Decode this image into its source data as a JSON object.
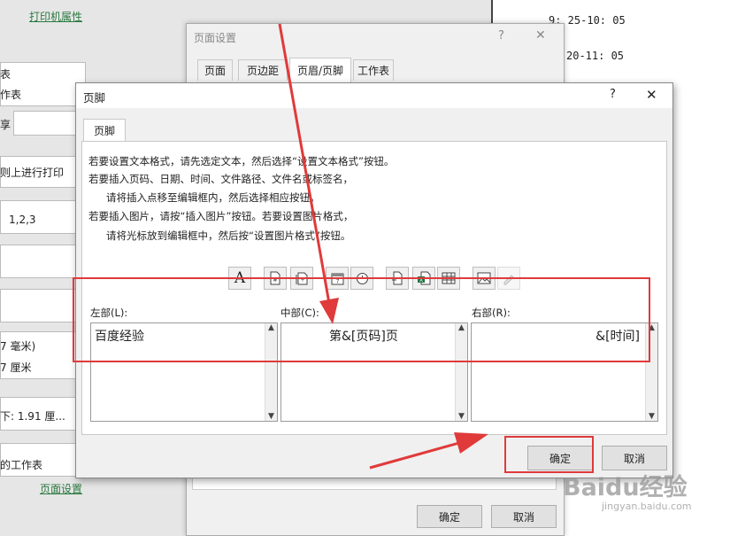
{
  "background": {
    "printer_properties_link": "打印机属性",
    "items": [
      "表",
      "作表",
      "享",
      "则上进行打印",
      "1,2,3",
      "7 毫米)",
      "7 厘米",
      "下: 1.91 厘...",
      "的工作表"
    ],
    "page_setup_link": "页面设置"
  },
  "right_panel": {
    "times": [
      "9: 25-10: 05",
      "20-11: 05"
    ]
  },
  "page_setup_dialog": {
    "title": "页面设置",
    "help": "?",
    "close": "✕",
    "tabs": [
      "页面",
      "页边距",
      "页眉/页脚",
      "工作表"
    ],
    "ok": "确定",
    "cancel": "取消"
  },
  "footer_dialog": {
    "title": "页脚",
    "help": "?",
    "close": "✕",
    "tab": "页脚",
    "instructions": [
      "若要设置文本格式，请先选定文本，然后选择“设置文本格式”按钮。",
      "若要插入页码、日期、时间、文件路径、文件名或标签名，",
      "请将插入点移至编辑框内，然后选择相应按钮。",
      "若要插入图片，请按“插入图片”按钮。若要设置图片格式，",
      "请将光标放到编辑框中，然后按“设置图片格式”按钮。"
    ],
    "sections": {
      "left": {
        "label": "左部(L):",
        "value": "百度经验"
      },
      "center": {
        "label": "中部(C):",
        "value": "第&[页码]页"
      },
      "right": {
        "label": "右部(R):",
        "value": "&[时间]"
      }
    },
    "ok": "确定",
    "cancel": "取消"
  },
  "watermark": {
    "brand": "Baidu经验",
    "url": "jingyan.baidu.com"
  },
  "colors": {
    "annotation": "#e03a3a",
    "link": "#2a7a3f"
  }
}
